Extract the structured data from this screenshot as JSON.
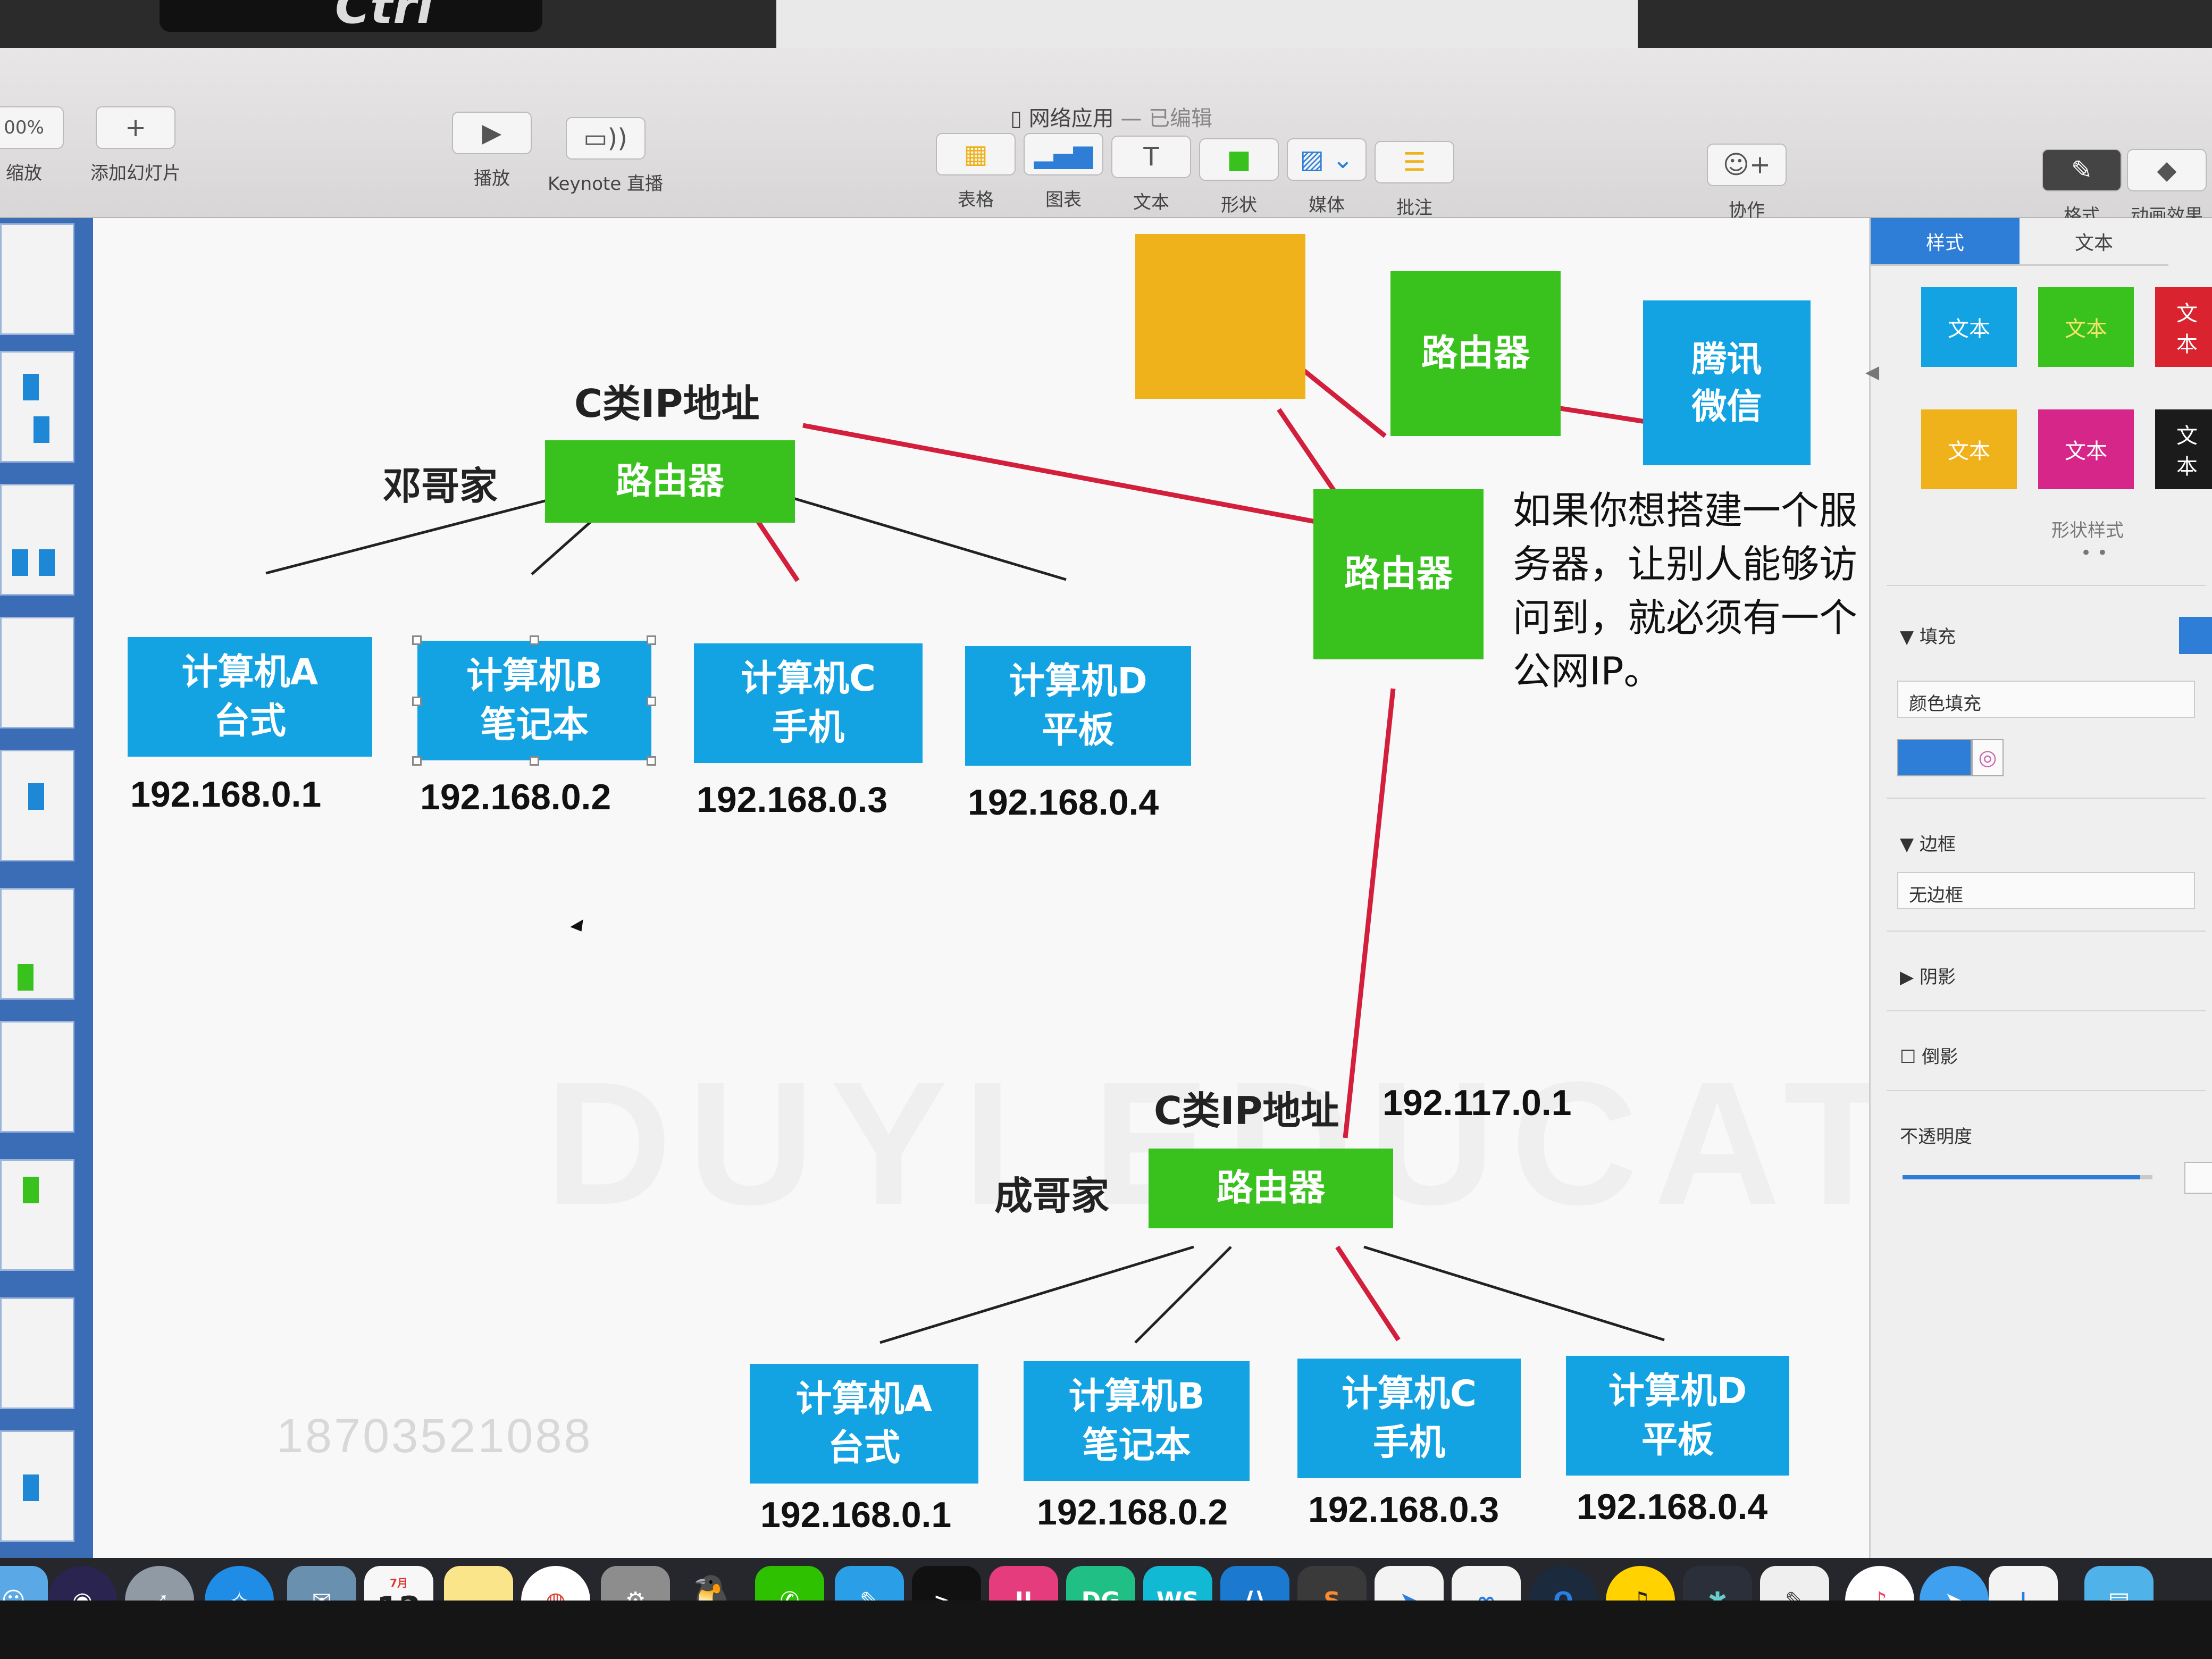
{
  "window": {
    "title": "网络应用",
    "status": "— 已编辑"
  },
  "bezel": {
    "key_label": "Ctrl"
  },
  "toolbar": {
    "zoom": "00%",
    "zoom_label": "缩放",
    "add_slide": "添加幻灯片",
    "play": "播放",
    "keynote_live": "Keynote 直播",
    "table": "表格",
    "chart": "图表",
    "text": "文本",
    "shape": "形状",
    "media": "媒体",
    "comment": "批注",
    "collaborate": "协作",
    "format": "格式",
    "animate": "动画效果"
  },
  "slide": {
    "top_network": {
      "ip_class": "C类IP地址",
      "home": "邓哥家",
      "router": "路由器",
      "computers": [
        {
          "name": "计算机A",
          "type": "台式",
          "ip": "192.168.0.1"
        },
        {
          "name": "计算机B",
          "type": "笔记本",
          "ip": "192.168.0.2"
        },
        {
          "name": "计算机C",
          "type": "手机",
          "ip": "192.168.0.3"
        },
        {
          "name": "计算机D",
          "type": "平板",
          "ip": "192.168.0.4"
        }
      ]
    },
    "bottom_network": {
      "ip_class": "C类IP地址",
      "public_ip": "192.117.0.1",
      "home": "成哥家",
      "router": "路由器",
      "computers": [
        {
          "name": "计算机A",
          "type": "台式",
          "ip": "192.168.0.1"
        },
        {
          "name": "计算机B",
          "type": "笔记本",
          "ip": "192.168.0.2"
        },
        {
          "name": "计算机C",
          "type": "手机",
          "ip": "192.168.0.3"
        },
        {
          "name": "计算机D",
          "type": "平板",
          "ip": "192.168.0.4"
        }
      ]
    },
    "middle_router": "路由器",
    "upper_router": "路由器",
    "service": "腾讯\n微信",
    "note": "如果你想搭建一个服务器，让别人能够访问到，就必须有一个公网IP。",
    "phone": "18703521088",
    "watermark": "DUYI EDUCATION"
  },
  "inspector": {
    "tabs": [
      "样式",
      "文本"
    ],
    "swatch_label": "文本",
    "shape_styles": "形状样式",
    "fill": "填充",
    "fill_type": "颜色填充",
    "border": "边框",
    "border_type": "无边框",
    "shadow": "阴影",
    "reflection": "倒影",
    "opacity": "不透明度",
    "opacity_level": 0.95,
    "colors": {
      "active_tab": "#2e7ed8",
      "blue": "#13a3e3",
      "green": "#39c21e",
      "red": "#d9232e",
      "orange": "#f0b21a",
      "magenta": "#d6268a",
      "black": "#1b1b1b"
    }
  },
  "dock": {
    "calendar_day": "12",
    "calendar_month": "7月"
  },
  "colors": {
    "router": "#39c21e",
    "computer": "#13a3e3",
    "server": "#f0b21a",
    "link": "#222222",
    "red_link": "#d31e3c"
  }
}
